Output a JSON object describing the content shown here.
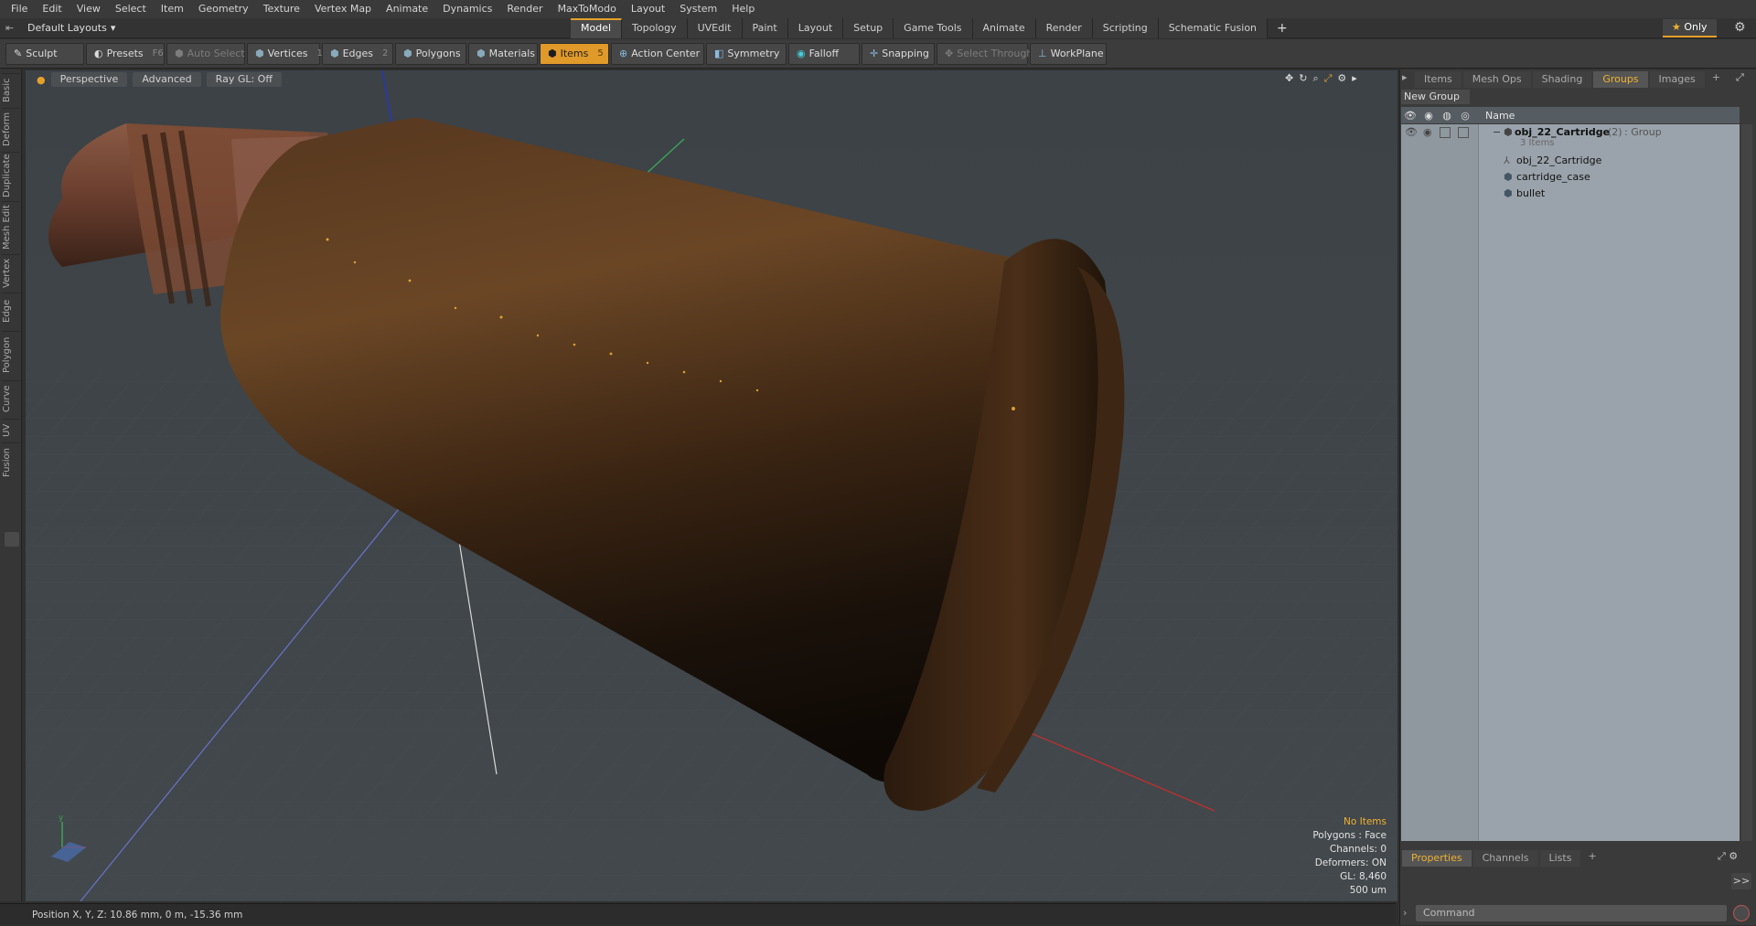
{
  "menu": [
    "File",
    "Edit",
    "View",
    "Select",
    "Item",
    "Geometry",
    "Texture",
    "Vertex Map",
    "Animate",
    "Dynamics",
    "Render",
    "MaxToModo",
    "Layout",
    "System",
    "Help"
  ],
  "layout_dropdown": "Default Layouts",
  "tabs": [
    "Model",
    "Topology",
    "UVEdit",
    "Paint",
    "Layout",
    "Setup",
    "Game Tools",
    "Animate",
    "Render",
    "Scripting",
    "Schematic Fusion"
  ],
  "tab_add": "+",
  "only_label": "Only",
  "toolbar": {
    "sculpt": "Sculpt",
    "presets": "Presets",
    "presets_key": "F6",
    "auto_select": "Auto Select",
    "vertices": "Vertices",
    "vertices_count": "1",
    "edges": "Edges",
    "edges_count": "2",
    "polygons": "Polygons",
    "materials": "Materials",
    "items": "Items",
    "items_count": "5",
    "action_center": "Action Center",
    "symmetry": "Symmetry",
    "falloff": "Falloff",
    "snapping": "Snapping",
    "select_through": "Select Through",
    "workplane": "WorkPlane"
  },
  "left_tabs": [
    "Basic",
    "Deform",
    "Duplicate",
    "Mesh Edit",
    "Vertex",
    "Edge",
    "Polygon",
    "Curve",
    "UV",
    "Fusion"
  ],
  "viewport": {
    "view": "Perspective",
    "shading": "Advanced",
    "raygl": "Ray GL: Off",
    "info": {
      "selection": "No Items",
      "polygons": "Polygons : Face",
      "channels": "Channels: 0",
      "deformers": "Deformers: ON",
      "gl": "GL: 8,460",
      "scale": "500 um"
    },
    "icons": [
      "move-icon",
      "rotate-icon",
      "zoom-icon",
      "maximize-icon",
      "settings-icon",
      "arrow-icon"
    ]
  },
  "status": "Position X, Y, Z:  10.86 mm, 0 m, -15.36 mm",
  "right_panel": {
    "tabs": [
      "Items",
      "Mesh Ops",
      "Shading",
      "Groups",
      "Images"
    ],
    "active_tab": "Groups",
    "new_group": "New Group",
    "column_name": "Name",
    "group": {
      "name": "obj_22_Cartridge",
      "count": "(2)",
      "type": ": Group",
      "items_label": "3 Items"
    },
    "children": [
      "obj_22_Cartridge",
      "cartridge_case",
      "bullet"
    ],
    "bottom_tabs": [
      "Properties",
      "Channels",
      "Lists"
    ],
    "bottom_active": "Properties",
    "command_placeholder": "Command",
    "expand": ">>"
  },
  "colors": {
    "accent": "#e6a02a",
    "viewport_bg": "#3f4549",
    "list_bg": "#9aa3ab"
  }
}
